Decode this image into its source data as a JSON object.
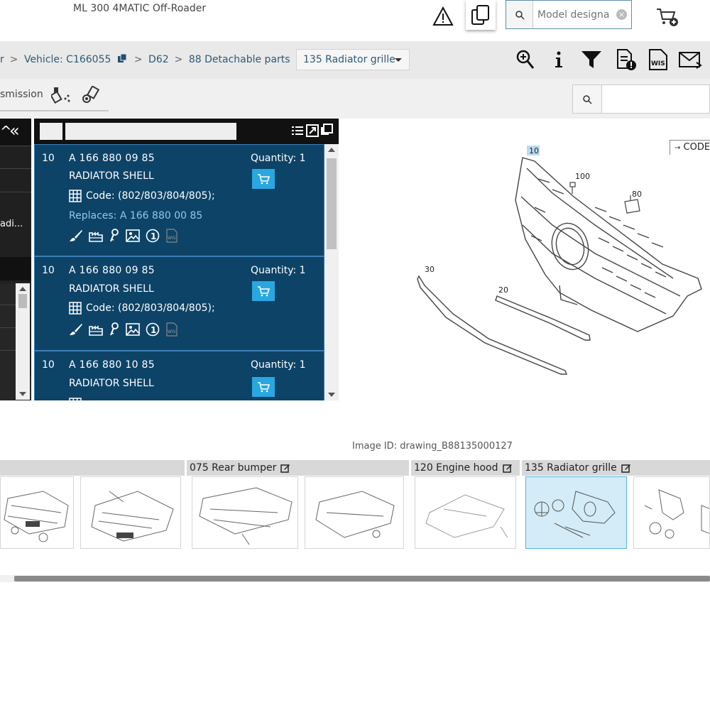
{
  "header": {
    "vehicle_title": "ML 300 4MATIC Off-Roader",
    "model_search_placeholder": "Model designa",
    "icons": [
      "warning-icon",
      "copy-icon",
      "search-icon",
      "add-to-cart-icon"
    ]
  },
  "breadcrumb": {
    "items": [
      "r",
      "Vehicle: C166055",
      "D62",
      "88 Detachable parts"
    ],
    "selected": "135 Radiator grille",
    "tools": [
      "zoom-icon",
      "info-icon",
      "filter-icon",
      "document-alert-icon",
      "wis-icon",
      "mail-icon"
    ]
  },
  "subbar": {
    "tab_label": "smission",
    "icons": [
      "spray-icon",
      "bolt-icon",
      "search-icon"
    ]
  },
  "left_panel": {
    "item_label": "adi..."
  },
  "parts": [
    {
      "pos": "10",
      "number": "A 166 880 09 85",
      "desc": "RADIATOR SHELL",
      "code": "Code: (802/803/804/805);",
      "replaces": "Replaces: A 166 880 00 85",
      "quantity": "Quantity: 1",
      "wis": "WIS"
    },
    {
      "pos": "10",
      "number": "A 166 880 09 85",
      "desc": "RADIATOR SHELL",
      "code": "Code: (802/803/804/805);",
      "quantity": "Quantity: 1",
      "wis": "WIS"
    },
    {
      "pos": "10",
      "number": "A 166 880 10 85",
      "desc": "RADIATOR SHELL",
      "quantity": "Quantity: 1"
    }
  ],
  "drawing": {
    "code_button": "CODE",
    "callouts": [
      "10",
      "100",
      "80",
      "30",
      "20"
    ],
    "image_id": "Image ID: drawing_B88135000127"
  },
  "thumbnails": {
    "labels": [
      "075 Rear bumper",
      "120 Engine hood",
      "135 Radiator grille"
    ]
  },
  "colors": {
    "accent": "#29a7e1",
    "parts_bg": "#0d4367",
    "selected_thumb": "#d3ecf8"
  }
}
